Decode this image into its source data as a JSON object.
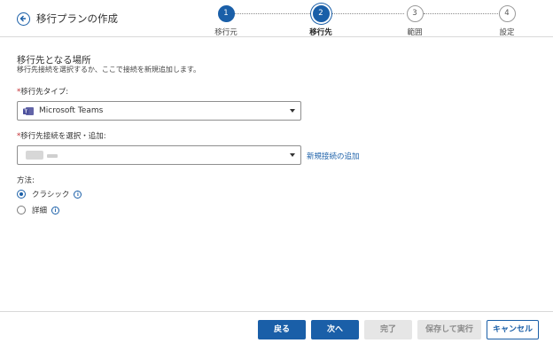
{
  "header": {
    "title": "移行プランの作成",
    "steps": [
      {
        "number": "1",
        "label": "移行元",
        "state": "done"
      },
      {
        "number": "2",
        "label": "移行先",
        "state": "current"
      },
      {
        "number": "3",
        "label": "範囲",
        "state": "future"
      },
      {
        "number": "4",
        "label": "設定",
        "state": "future"
      }
    ]
  },
  "main": {
    "section_title": "移行先となる場所",
    "section_desc": "移行先接続を選択するか、ここで接続を新規追加します。",
    "destination_type": {
      "required_mark": "*",
      "label": "移行先タイプ:",
      "value": "Microsoft Teams",
      "icon": "microsoft-teams-icon"
    },
    "connection": {
      "required_mark": "*",
      "label": "移行先接続を選択・追加:",
      "add_link": "新規接続の追加"
    },
    "method": {
      "label": "方法:",
      "options": [
        {
          "label": "クラシック",
          "selected": true
        },
        {
          "label": "詳細",
          "selected": false
        }
      ]
    }
  },
  "footer": {
    "back": "戻る",
    "next": "次へ",
    "finish": "完了",
    "save_run": "保存して実行",
    "cancel": "キャンセル"
  },
  "colors": {
    "accent": "#1a5fa8",
    "required": "#c0282d",
    "disabled_bg": "#e6e6e6"
  }
}
